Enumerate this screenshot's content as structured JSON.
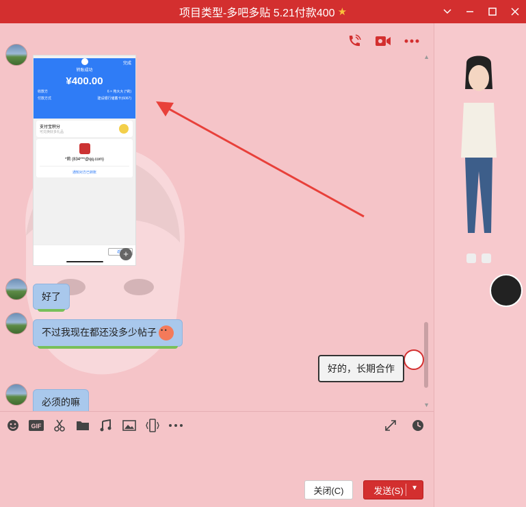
{
  "window": {
    "title": "项目类型-多吧多贴 5.21付款400",
    "star_icon": "star-icon",
    "controls": [
      "chevron-down-icon",
      "minimize-icon",
      "maximize-icon",
      "close-icon"
    ]
  },
  "chat_toolbar": [
    "phone-call-icon",
    "video-call-icon",
    "more-icon"
  ],
  "phone_screenshot": {
    "done": "完成",
    "status": "转账成功",
    "amount": "¥400.00",
    "rows": [
      {
        "label": "收款方",
        "value": "6 × 苑大大 (*莉)"
      },
      {
        "label": "付款方式",
        "value": "建设银行储蓄卡(6067)"
      }
    ],
    "points_title": "支付宝积分",
    "points_sub": "可兑换好多礼品",
    "payee": "*莉 (834***@qq.com)",
    "notice": "通知对方已转账",
    "back": "返回"
  },
  "messages": [
    {
      "side": "left",
      "text": "好了"
    },
    {
      "side": "left",
      "text": "不过我现在都还没多少帖子"
    },
    {
      "side": "right",
      "text": "好的，长期合作"
    },
    {
      "side": "left",
      "text": "必须的嘛"
    }
  ],
  "input_tools": [
    "emoji-icon",
    "gif-icon",
    "scissors-icon",
    "folder-icon",
    "music-icon",
    "image-icon",
    "shake-icon",
    "more-icon"
  ],
  "input_tools_right": [
    "expand-icon",
    "history-clock-icon"
  ],
  "buttons": {
    "close": "关闭(C)",
    "send": "发送(S)"
  },
  "colors": {
    "brand_red": "#d32f2f",
    "background_pink": "#f5c4c8",
    "bubble_blue": "#a9c8ec"
  }
}
